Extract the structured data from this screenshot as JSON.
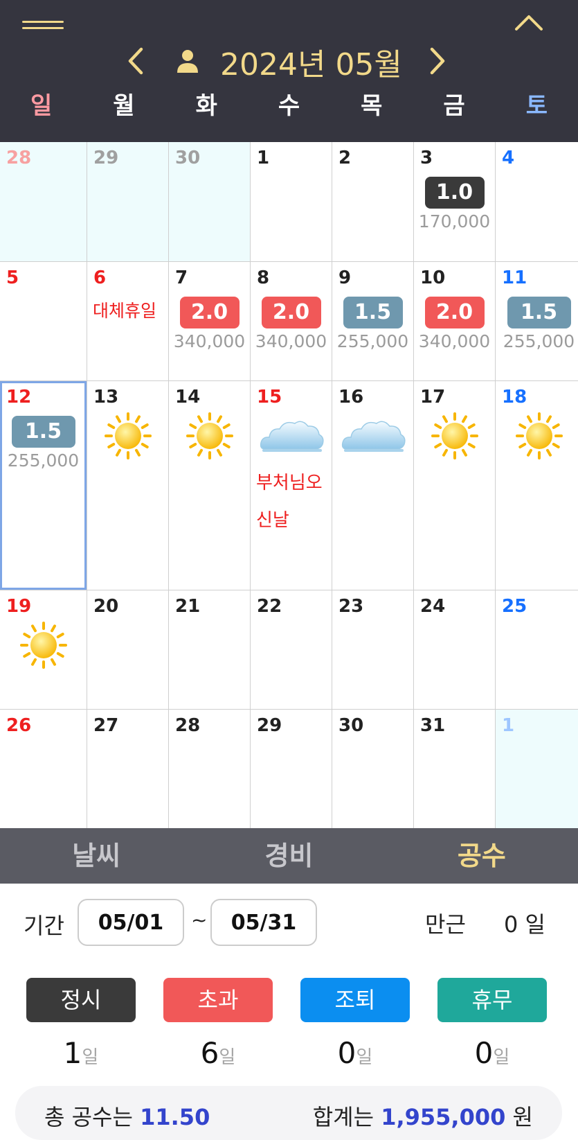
{
  "header": {
    "month_title": "2024년 05월",
    "weekdays": [
      "일",
      "월",
      "화",
      "수",
      "목",
      "금",
      "토"
    ]
  },
  "calendar": {
    "colors": {
      "regular": "#3a3a3a",
      "overtime": "#f15858",
      "partial": "#6f98ae"
    },
    "weeks": [
      [
        {
          "day": "28",
          "tone": "faint-red",
          "other": true
        },
        {
          "day": "29",
          "tone": "faint",
          "other": true
        },
        {
          "day": "30",
          "tone": "faint",
          "other": true
        },
        {
          "day": "1",
          "tone": "normal"
        },
        {
          "day": "2",
          "tone": "normal"
        },
        {
          "day": "3",
          "tone": "normal",
          "badge": "1.0",
          "badge_color": "#3a3a3a",
          "amount": "170,000"
        },
        {
          "day": "4",
          "tone": "blue"
        }
      ],
      [
        {
          "day": "5",
          "tone": "red"
        },
        {
          "day": "6",
          "tone": "red",
          "holiday": "대체휴일"
        },
        {
          "day": "7",
          "tone": "normal",
          "badge": "2.0",
          "badge_color": "#f15858",
          "amount": "340,000"
        },
        {
          "day": "8",
          "tone": "normal",
          "badge": "2.0",
          "badge_color": "#f15858",
          "amount": "340,000"
        },
        {
          "day": "9",
          "tone": "normal",
          "badge": "1.5",
          "badge_color": "#6f98ae",
          "amount": "255,000"
        },
        {
          "day": "10",
          "tone": "normal",
          "badge": "2.0",
          "badge_color": "#f15858",
          "amount": "340,000"
        },
        {
          "day": "11",
          "tone": "blue",
          "badge": "1.5",
          "badge_color": "#6f98ae",
          "amount": "255,000"
        }
      ],
      [
        {
          "day": "12",
          "tone": "red",
          "selected": true,
          "badge": "1.5",
          "badge_color": "#6f98ae",
          "amount": "255,000"
        },
        {
          "day": "13",
          "tone": "normal",
          "weather": "sun-icon"
        },
        {
          "day": "14",
          "tone": "normal",
          "weather": "sun-icon"
        },
        {
          "day": "15",
          "tone": "red",
          "weather": "cloud-icon",
          "holiday": "부처님오신날"
        },
        {
          "day": "16",
          "tone": "normal",
          "weather": "cloud-icon"
        },
        {
          "day": "17",
          "tone": "normal",
          "weather": "sun-icon"
        },
        {
          "day": "18",
          "tone": "blue",
          "weather": "sun-icon"
        }
      ],
      [
        {
          "day": "19",
          "tone": "red",
          "weather": "sun-icon"
        },
        {
          "day": "20",
          "tone": "normal"
        },
        {
          "day": "21",
          "tone": "normal"
        },
        {
          "day": "22",
          "tone": "normal"
        },
        {
          "day": "23",
          "tone": "normal"
        },
        {
          "day": "24",
          "tone": "normal"
        },
        {
          "day": "25",
          "tone": "blue"
        }
      ],
      [
        {
          "day": "26",
          "tone": "red"
        },
        {
          "day": "27",
          "tone": "normal"
        },
        {
          "day": "28",
          "tone": "normal"
        },
        {
          "day": "29",
          "tone": "normal"
        },
        {
          "day": "30",
          "tone": "normal"
        },
        {
          "day": "31",
          "tone": "normal"
        },
        {
          "day": "1",
          "tone": "faint-blue",
          "other": true
        }
      ]
    ]
  },
  "tabs": {
    "weather": "날씨",
    "expense": "경비",
    "gongsu": "공수"
  },
  "summary": {
    "period_label": "기간",
    "start_date": "05/01",
    "tilde": "~",
    "end_date": "05/31",
    "mangeun_label": "만근",
    "mangeun_value": "0 일",
    "categories": [
      {
        "label": "정시",
        "color": "#3a3a3a",
        "count": "1",
        "unit": "일"
      },
      {
        "label": "초과",
        "color": "#f15858",
        "count": "6",
        "unit": "일"
      },
      {
        "label": "조퇴",
        "color": "#0b8ef0",
        "count": "0",
        "unit": "일"
      },
      {
        "label": "휴무",
        "color": "#1fa89b",
        "count": "0",
        "unit": "일"
      }
    ],
    "total_prefix": "총 공수는",
    "total_value": "11.50",
    "sum_prefix": "합계는",
    "sum_value": "1,955,000",
    "sum_unit": "원"
  }
}
